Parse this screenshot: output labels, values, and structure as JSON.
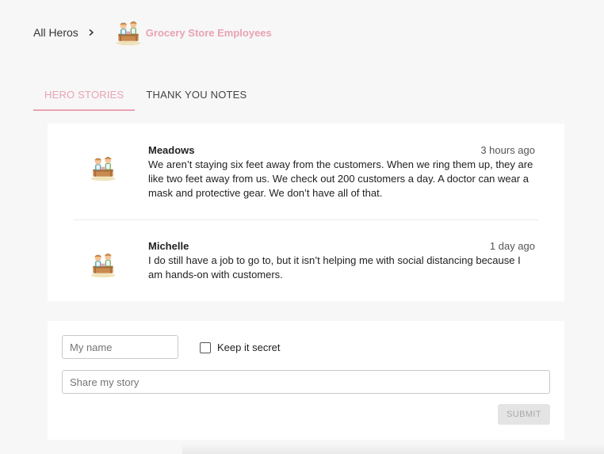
{
  "breadcrumb": {
    "root_label": "All Heros",
    "separator_icon": "chevron-right-icon",
    "current_label": "Grocery Store Employees",
    "avatar_icon": "grocery-workers-avatar-icon"
  },
  "tabs": [
    {
      "label": "HERO STORIES",
      "active": true
    },
    {
      "label": "THANK YOU NOTES",
      "active": false
    }
  ],
  "stories": [
    {
      "name": "Meadows",
      "time": "3 hours ago",
      "text": "We aren’t staying six feet away from the customers. When we ring them up, they are like two feet away from us. We check out 200 customers a day. A doctor can wear a mask and protective gear. We don’t have all of that.",
      "avatar_icon": "grocery-workers-avatar-icon"
    },
    {
      "name": "Michelle",
      "time": "1 day ago",
      "text": "I do still have a job to go to, but it isn’t helping me with social distancing because I am hands-on with customers.",
      "avatar_icon": "grocery-workers-avatar-icon"
    }
  ],
  "form": {
    "name_placeholder": "My name",
    "name_value": "",
    "secret_label": "Keep it secret",
    "secret_checked": false,
    "story_placeholder": "Share my story",
    "story_value": "",
    "submit_label": "SUBMIT"
  },
  "colors": {
    "accent": "#e8a3b4",
    "background": "#f7f7f7",
    "card": "#ffffff",
    "submit_disabled_bg": "#e4e4e4",
    "submit_disabled_text": "#a9a9a9"
  }
}
